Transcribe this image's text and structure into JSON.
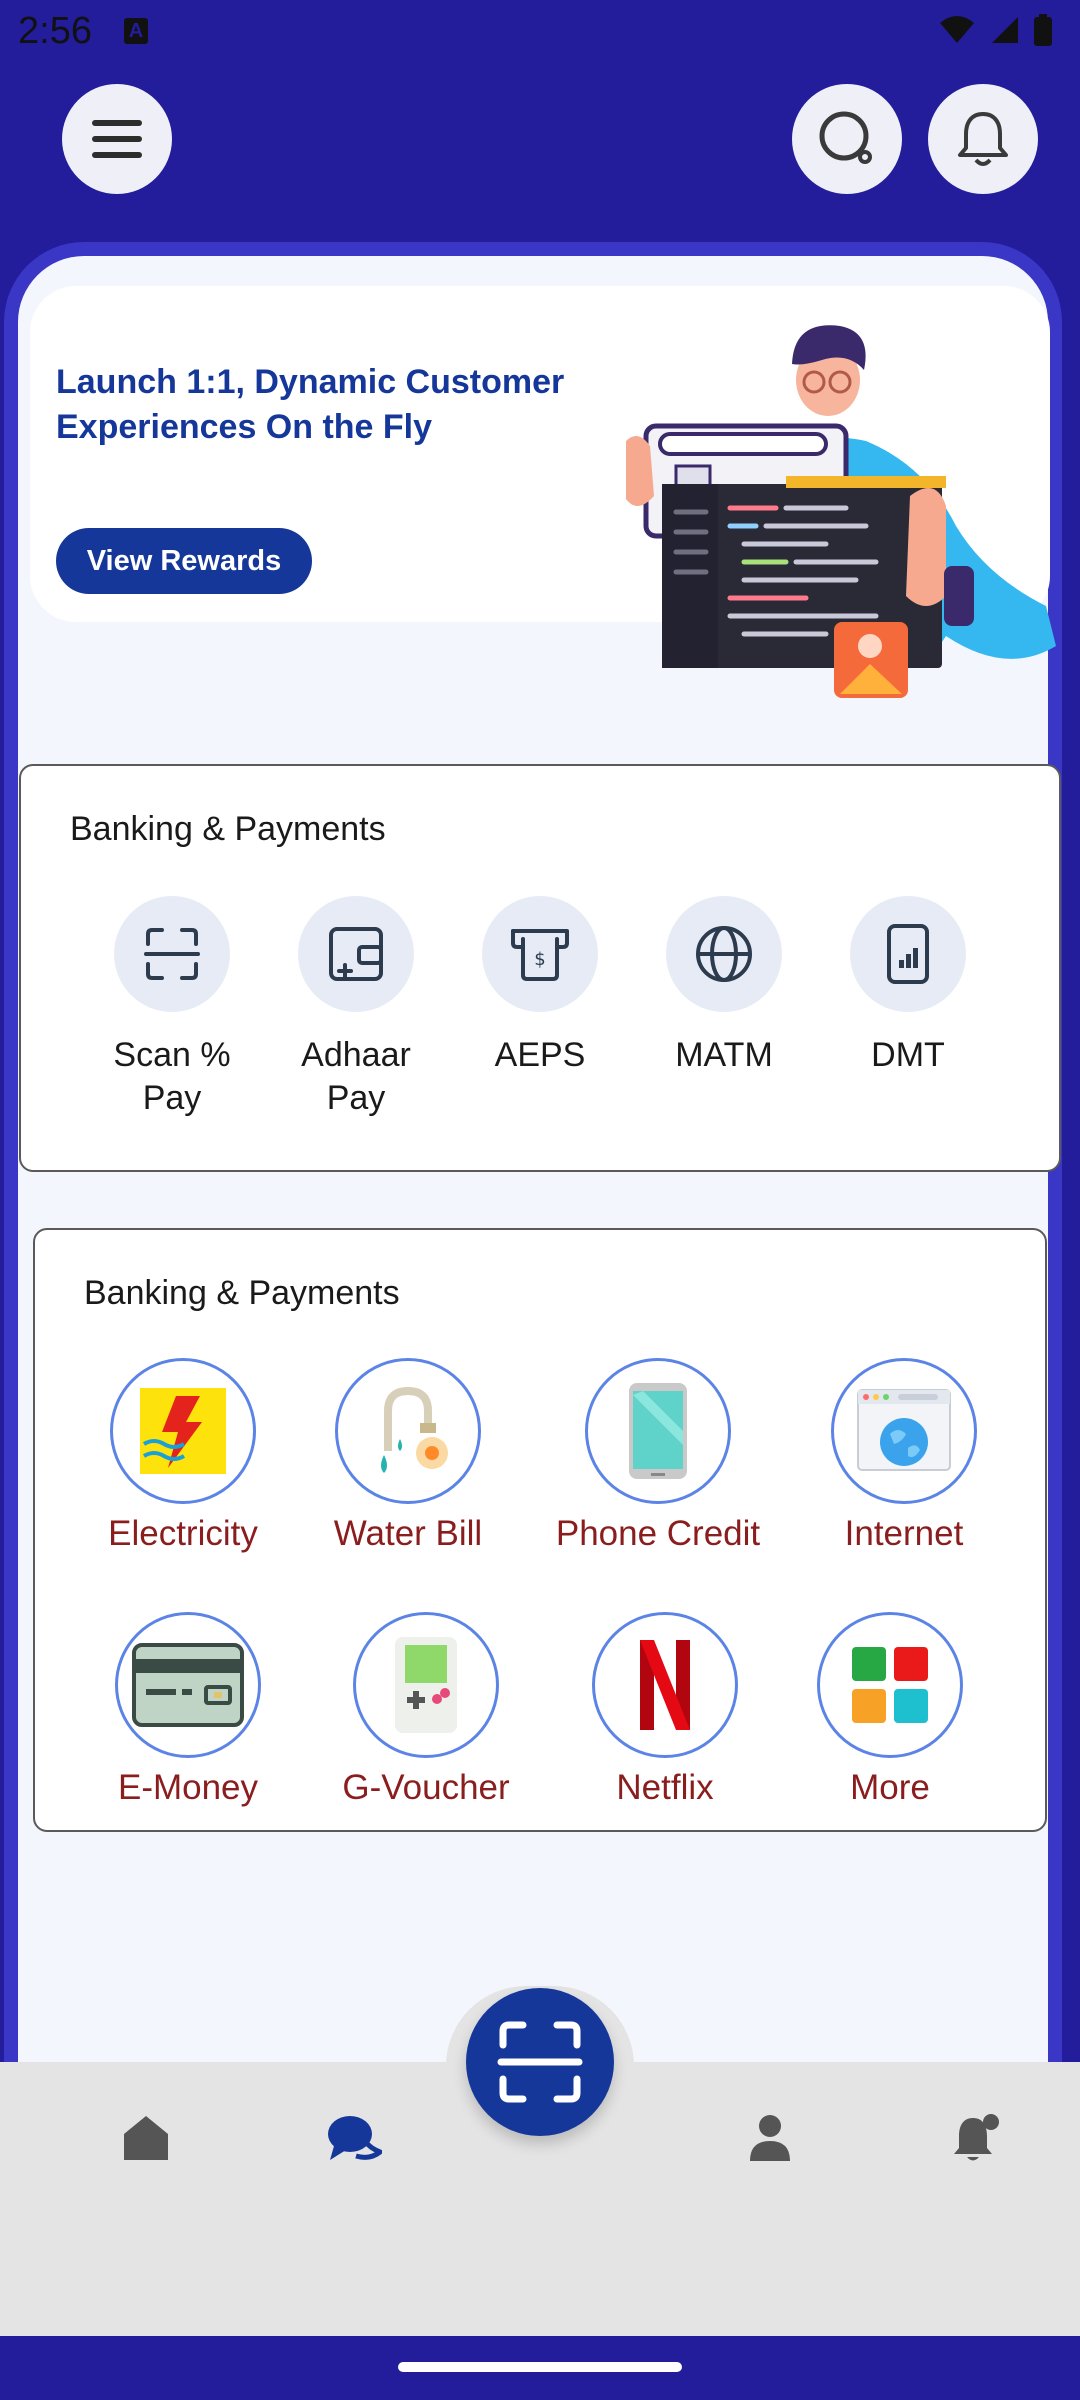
{
  "status_bar": {
    "time": "2:56",
    "notification_badge": "A"
  },
  "header": {
    "menu_icon": "menu-icon",
    "search_icon": "search-icon",
    "bell_icon": "bell-icon"
  },
  "banner": {
    "title": "Launch 1:1, Dynamic Customer Experiences On the Fly",
    "button_label": "View Rewards"
  },
  "banking": {
    "title": "Banking & Payments",
    "items": [
      {
        "label": "Scan % Pay",
        "icon": "scan-icon"
      },
      {
        "label": "Adhaar Pay",
        "icon": "wallet-icon"
      },
      {
        "label": "AEPS",
        "icon": "atm-icon"
      },
      {
        "label": "MATM",
        "icon": "globe-icon"
      },
      {
        "label": "DMT",
        "icon": "phone-signal-icon"
      }
    ]
  },
  "services": {
    "title": "Banking & Payments",
    "items": [
      {
        "label": "Electricity",
        "icon": "electricity-icon"
      },
      {
        "label": "Water Bill",
        "icon": "water-tap-icon"
      },
      {
        "label": "Phone Credit",
        "icon": "smartphone-icon"
      },
      {
        "label": "Internet",
        "icon": "internet-globe-icon"
      },
      {
        "label": "E-Money",
        "icon": "card-icon"
      },
      {
        "label": "G-Voucher",
        "icon": "gameboy-icon"
      },
      {
        "label": "Netflix",
        "icon": "netflix-icon"
      },
      {
        "label": "More",
        "icon": "grid-icon"
      }
    ]
  },
  "bottom_nav": {
    "items": [
      {
        "icon": "home-icon"
      },
      {
        "icon": "chat-icon",
        "active": true
      },
      {
        "icon": "scan-fab-icon"
      },
      {
        "icon": "profile-icon"
      },
      {
        "icon": "notification-icon"
      }
    ]
  },
  "colors": {
    "brand": "#231d9b",
    "primary": "#15379a",
    "label": "#8a1e1e"
  }
}
